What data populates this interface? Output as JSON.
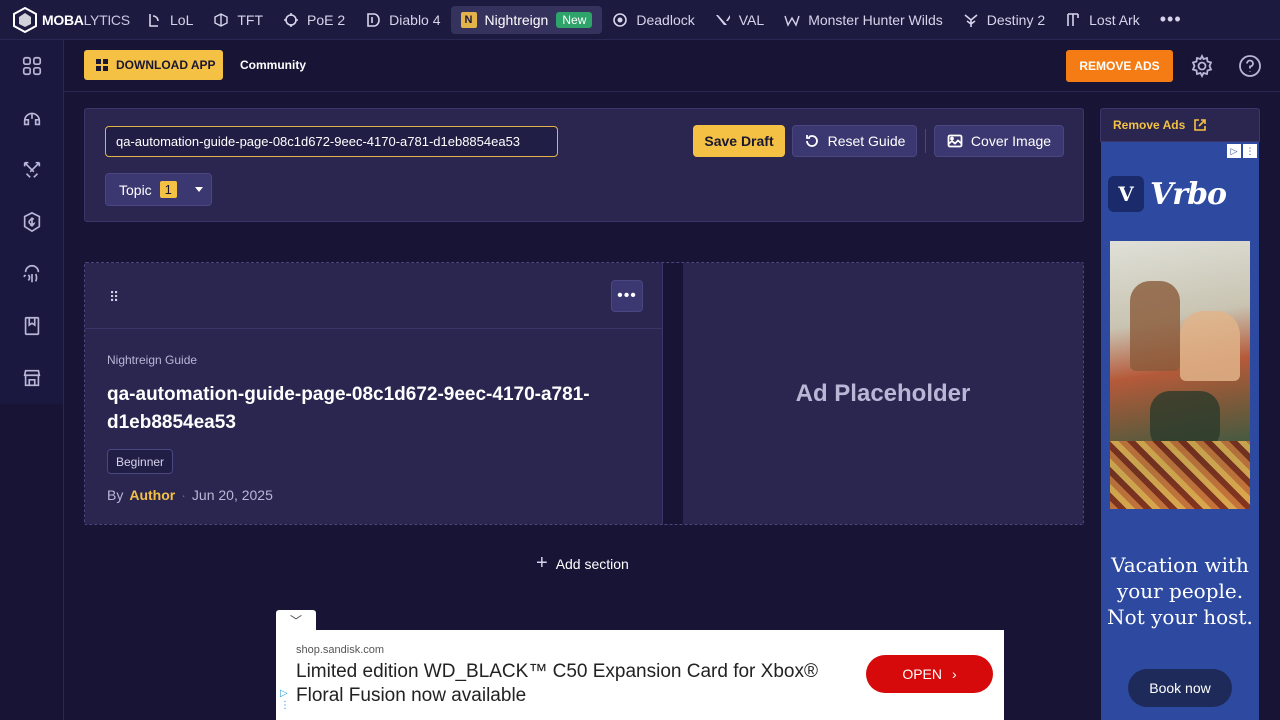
{
  "topnav": {
    "logo": {
      "bold": "MOBA",
      "light": "LYTICS"
    },
    "games": [
      {
        "label": "LoL",
        "icon": "lol-icon"
      },
      {
        "label": "TFT",
        "icon": "tft-icon"
      },
      {
        "label": "PoE 2",
        "icon": "poe-icon"
      },
      {
        "label": "Diablo 4",
        "icon": "diablo-icon"
      },
      {
        "label": "Nightreign",
        "icon": "nightreign-icon",
        "badge": "New",
        "active": true
      },
      {
        "label": "Deadlock",
        "icon": "deadlock-icon"
      },
      {
        "label": "VAL",
        "icon": "valorant-icon"
      },
      {
        "label": "Monster Hunter Wilds",
        "icon": "monster-hunter-icon"
      },
      {
        "label": "Destiny 2",
        "icon": "destiny-icon"
      },
      {
        "label": "Lost Ark",
        "icon": "lost-ark-icon"
      }
    ],
    "nightreign_letter": "N",
    "more": "•••"
  },
  "sidebar": {
    "items": [
      "grid-icon",
      "headset-icon",
      "swords-icon",
      "coin-shield-icon",
      "fingerprint-icon",
      "book-icon",
      "store-icon"
    ]
  },
  "subheader": {
    "download_label": "DOWNLOAD APP",
    "community_label": "Community",
    "remove_ads_label": "REMOVE ADS"
  },
  "editor": {
    "title_value": "qa-automation-guide-page-08c1d672-9eec-4170-a781-d1eb8854ea53",
    "save_label": "Save Draft",
    "reset_label": "Reset Guide",
    "cover_label": "Cover Image",
    "topic_label": "Topic",
    "topic_count": "1"
  },
  "guide_card": {
    "drag": "⠿",
    "menu": "•••",
    "category": "Nightreign Guide",
    "title": "qa-automation-guide-page-08c1d672-9eec-4170-a781-d1eb8854ea53",
    "tag": "Beginner",
    "by": "By",
    "author": "Author",
    "sep": "·",
    "date": "Jun 20, 2025"
  },
  "ad_placeholder": "Ad Placeholder",
  "add_section": {
    "plus": "+",
    "label": "Add section"
  },
  "right_ad": {
    "remove_ads_label": "Remove Ads",
    "brand_letter": "V",
    "brand": "Vrbo",
    "headline": "Vacation with your people. Not your host.",
    "cta": "Book now",
    "adchoices": [
      "▷",
      "⋮"
    ]
  },
  "bottom_ad": {
    "toggle": "﹀",
    "domain": "shop.sandisk.com",
    "text": "Limited edition WD_BLACK™ C50 Expansion Card for Xbox® Floral Fusion now available",
    "cta": "OPEN",
    "cta_arrow": "›",
    "adchoice": "▷\n⋮"
  },
  "colors": {
    "background": "#171436",
    "accent_yellow": "#f4c145",
    "remove_ads_orange": "#f57c14",
    "new_badge_green": "#2ea36a",
    "open_red": "#d60a0a"
  }
}
